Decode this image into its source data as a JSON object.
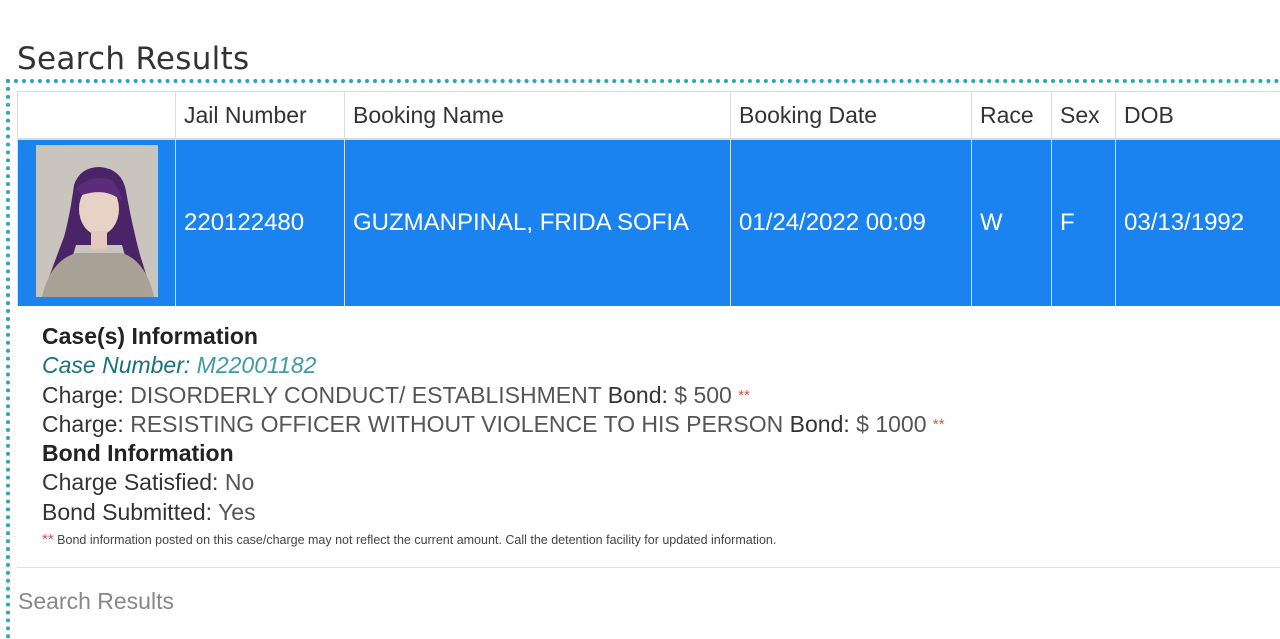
{
  "page": {
    "title": "Search Results",
    "bottom_label": "Search Results"
  },
  "table": {
    "headers": [
      "",
      "Jail Number",
      "Booking Name",
      "Booking Date",
      "Race",
      "Sex",
      "DOB"
    ],
    "row": {
      "jail_number": "220122480",
      "booking_name": "GUZMANPINAL, FRIDA SOFIA",
      "booking_date": "01/24/2022 00:09",
      "race": "W",
      "sex": "F",
      "dob": "03/13/1992"
    }
  },
  "case_info": {
    "heading": "Case(s) Information",
    "case_number_label": "Case Number:",
    "case_number": "M22001182",
    "charges": [
      {
        "label": "Charge:",
        "text": "DISORDERLY CONDUCT/ ESTABLISHMENT",
        "bond_label": "Bond:",
        "bond": "$ 500",
        "marker": "**"
      },
      {
        "label": "Charge:",
        "text": "RESISTING OFFICER WITHOUT VIOLENCE TO HIS PERSON",
        "bond_label": "Bond:",
        "bond": "$ 1000",
        "marker": "**"
      }
    ]
  },
  "bond_info": {
    "heading": "Bond Information",
    "charge_satisfied_label": "Charge Satisfied:",
    "charge_satisfied": "No",
    "bond_submitted_label": "Bond Submitted:",
    "bond_submitted": "Yes"
  },
  "footnote": {
    "marker": "**",
    "text": "Bond information posted on this case/charge may not reflect the current amount. Call the detention facility for updated information."
  },
  "colors": {
    "row_highlight": "#1a83f0",
    "accent_dotted": "#2aa6b5",
    "case_label": "#17727d",
    "marker": "#d9534f"
  }
}
